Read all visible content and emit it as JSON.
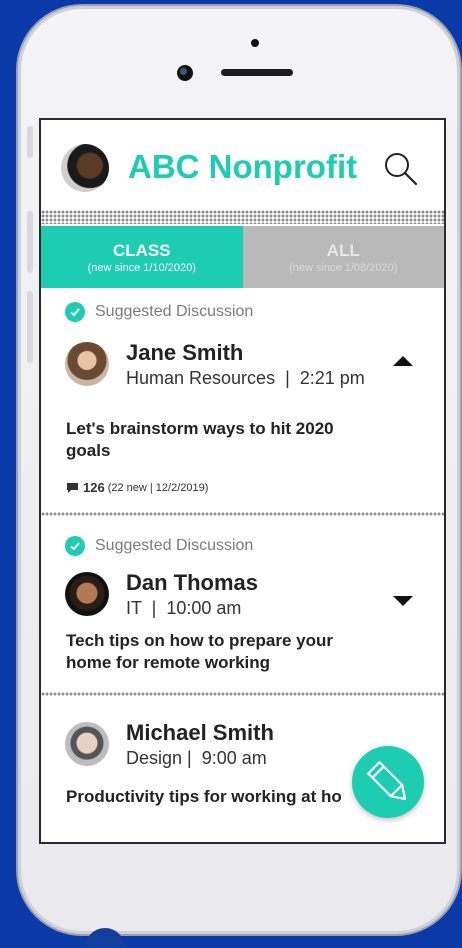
{
  "header": {
    "org_name": "ABC Nonprofit"
  },
  "tabs": [
    {
      "label": "CLASS",
      "sub": "(new since 1/10/2020)",
      "active": true
    },
    {
      "label": "ALL",
      "sub": "(new since 1/08/2020)",
      "active": false
    }
  ],
  "posts": [
    {
      "tag": "Suggested Discussion",
      "author": "Jane Smith",
      "meta": "Human Resources  |  2:21 pm",
      "title": "Let's brainstorm ways to hit 2020 goals",
      "comment_count": "126",
      "comment_detail": "(22 new | 12/2/2019)",
      "expanded": true
    },
    {
      "tag": "Suggested Discussion",
      "author": "Dan Thomas",
      "meta": "IT  |  10:00 am",
      "title": "Tech tips on how to prepare your home for remote working",
      "expanded": false
    },
    {
      "author": "Michael Smith",
      "meta": "Design |  9:00 am",
      "title": "Productivity tips for working at ho"
    }
  ],
  "colors": {
    "accent": "#1dcdb2",
    "background": "#0a3aa8",
    "tab_inactive": "#b9b9b9"
  },
  "icons": {
    "search": "search-icon",
    "check": "check-circle-icon",
    "comment": "comment-icon",
    "compose": "pencil-icon"
  }
}
